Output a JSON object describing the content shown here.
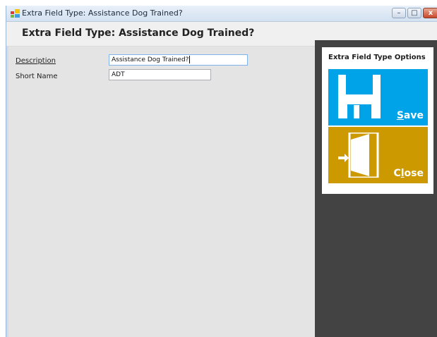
{
  "window": {
    "title": "Extra Field Type: Assistance Dog Trained?",
    "app_icon": "grid-app-icon",
    "controls": {
      "minimize": "–",
      "maximize": "□",
      "close": "x"
    }
  },
  "page": {
    "title": "Extra Field Type: Assistance Dog Trained?"
  },
  "form": {
    "description": {
      "label": "Description",
      "value": "Assistance Dog Trained?"
    },
    "short_name": {
      "label": "Short Name",
      "value": "ADT"
    }
  },
  "options_panel": {
    "title": "Extra Field Type Options",
    "save": {
      "pre": "",
      "accel": "S",
      "post": "ave",
      "icon": "floppy-disk-icon",
      "color": "#00a2e8"
    },
    "close": {
      "pre": "C",
      "accel": "l",
      "post": "ose",
      "icon": "open-door-icon",
      "color": "#cc9a00"
    }
  }
}
